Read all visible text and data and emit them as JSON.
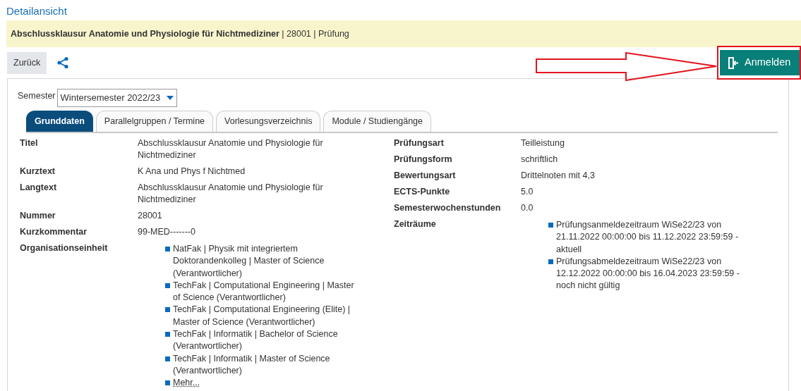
{
  "page_title": "Detailansicht",
  "header": {
    "title": "**Abschlussklausur Anatomie und Physiologie für Nichtmediziner** | 28001 | Prüfung"
  },
  "toolbar": {
    "back": "Zurück",
    "register": "Anmelden",
    "register_highlighted": true
  },
  "semester": {
    "label": "Semester",
    "value": "Wintersemester 2022/23"
  },
  "tabs": [
    {
      "label": "Grunddaten",
      "selected": true
    },
    {
      "label": "Parallelgruppen / Termine",
      "selected": false
    },
    {
      "label": "Vorlesungsverzeichnis",
      "selected": false
    },
    {
      "label": "Module / Studiengänge",
      "selected": false
    }
  ],
  "fields_left": [
    {
      "kind": "text",
      "label": "Titel",
      "value": "Abschlussklausur Anatomie und Physiologie für Nichtmediziner"
    },
    {
      "kind": "text",
      "label": "Kurztext",
      "value": "K Ana und Phys f Nichtmed"
    },
    {
      "kind": "text",
      "label": "Langtext",
      "value": "Abschlussklausur Anatomie und Physiologie für Nichtmediziner"
    },
    {
      "kind": "text",
      "label": "Nummer",
      "value": "28001"
    },
    {
      "kind": "text",
      "label": "Kurzkommentar",
      "value": "99-MED-------0"
    },
    {
      "kind": "list",
      "label": "Organisationseinheit",
      "items": [
        {
          "kind": "text",
          "text": "NatFak | Physik mit integriertem Doktorandenkolleg | Master of Science (Verantwortlicher)"
        },
        {
          "kind": "text",
          "text": "TechFak | Computational Engineering | Master of Science (Verantwortlicher)"
        },
        {
          "kind": "text",
          "text": "TechFak | Computational Engineering (Elite) | Master of Science (Verantwortlicher)"
        },
        {
          "kind": "text",
          "text": "TechFak | Informatik | Bachelor of Science (Verantwortlicher)"
        },
        {
          "kind": "text",
          "text": "TechFak | Informatik | Master of Science (Verantwortlicher)"
        },
        {
          "kind": "link",
          "text": "Mehr..."
        }
      ]
    }
  ],
  "fields_right": [
    {
      "kind": "text",
      "label": "Prüfungsart",
      "value": "Teilleistung"
    },
    {
      "kind": "text",
      "label": "Prüfungsform",
      "value": "schriftlich"
    },
    {
      "kind": "text",
      "label": "Bewertungsart",
      "value": "Drittelnoten mit 4,3"
    },
    {
      "kind": "text",
      "label": "ECTS-Punkte",
      "value": "5.0"
    },
    {
      "kind": "text",
      "label": "Semesterwochenstunden",
      "value": "0.0"
    },
    {
      "kind": "list",
      "label": "Zeiträume",
      "items": [
        {
          "kind": "text",
          "text": "Prüfungsanmeldezeitraum WiSe22/23 von 21.11.2022 00:00:00 bis 11.12.2022 23:59:59 - aktuell"
        },
        {
          "kind": "text",
          "text": "Prüfungsabmeldezeitraum WiSe22/23 von 12.12.2022 00:00:00 bis 16.04.2023 23:59:59 - noch nicht gültig"
        }
      ]
    }
  ]
}
